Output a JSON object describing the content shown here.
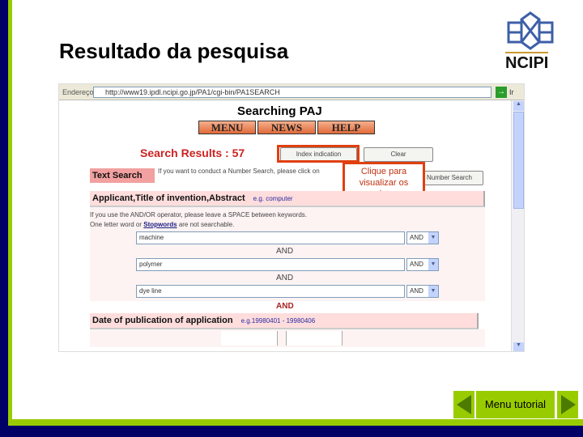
{
  "slide": {
    "title": "Resultado da pesquisa",
    "logo_text": "NCIPI",
    "menu_tutorial": "Menu tutorial"
  },
  "colors": {
    "navy": "#000066",
    "green": "#99cc00",
    "callout": "#e04010",
    "results_red": "#cc2222"
  },
  "browser": {
    "address_label": "Endereço",
    "url": "http://www19.ipdl.ncipi.go.jp/PA1/cgi-bin/PA1SEARCH",
    "go_label": "Ir"
  },
  "page": {
    "heading": "Searching PAJ",
    "nav": [
      "MENU",
      "NEWS",
      "HELP"
    ],
    "results_label": "Search Results : 57",
    "index_button": "Index indication",
    "clear_button": "Clear",
    "text_search": "Text Search",
    "number_search_text": "If you want to conduct a Number Search, please click on",
    "number_search_button": "Number Search",
    "callout": "Clique para visualizar os registros",
    "section1": {
      "title": "Applicant,Title of invention,Abstract",
      "example": "e.g. computer"
    },
    "hint1": "If you use the AND/OR operator, please leave a SPACE between keywords.",
    "hint2_pre": "One letter word or ",
    "hint2_link": "Stopwords",
    "hint2_post": " are not searchable.",
    "keywords": [
      {
        "value": "machine",
        "op": "AND"
      },
      {
        "value": "polymer",
        "op": "AND"
      },
      {
        "value": "dye line",
        "op": "AND"
      }
    ],
    "and_label": "AND",
    "section2": {
      "title": "Date of publication of application",
      "example": "e.g.19980401 - 19980406"
    }
  }
}
